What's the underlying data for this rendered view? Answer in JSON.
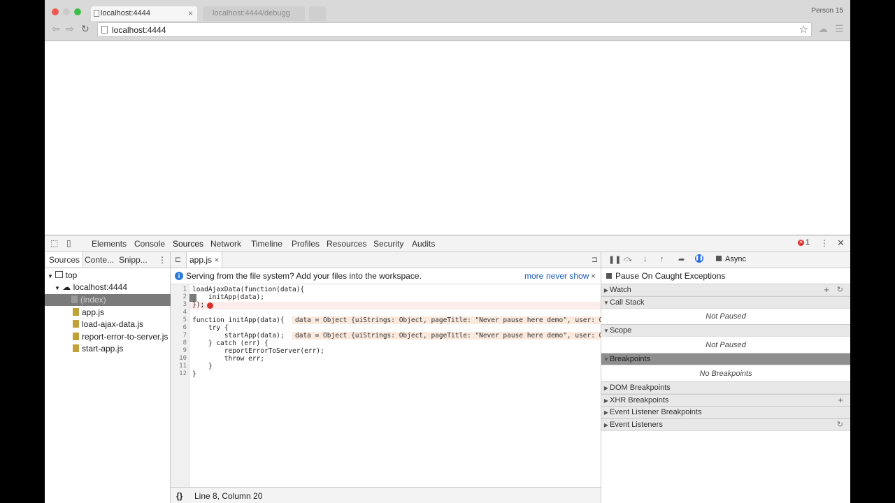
{
  "browser": {
    "tabs": [
      {
        "title": "localhost:4444"
      },
      {
        "title": "localhost:4444/debugg"
      }
    ],
    "profile": "Person 15",
    "url": "localhost:4444"
  },
  "devtools": {
    "tabs": [
      "Elements",
      "Console",
      "Sources",
      "Network",
      "Timeline",
      "Profiles",
      "Resources",
      "Security",
      "Audits"
    ],
    "active_tab": "Sources",
    "error_count": "1",
    "navigator": {
      "tabs": [
        "Sources",
        "Conte...",
        "Snipp..."
      ],
      "tree": [
        {
          "label": "top"
        },
        {
          "label": "localhost:4444"
        },
        {
          "label": "(index)"
        },
        {
          "label": "app.js"
        },
        {
          "label": "load-ajax-data.js"
        },
        {
          "label": "report-error-to-server.js"
        },
        {
          "label": "start-app.js"
        }
      ]
    },
    "editor": {
      "open_file": "app.js",
      "infobar_text": "Serving from the file system? Add your files into the workspace.",
      "infobar_more": "more",
      "infobar_never": "never show",
      "line_numbers": [
        "1",
        "2",
        "3",
        "4",
        "5",
        "6",
        "7",
        "8",
        "9",
        "10",
        "11",
        "12"
      ],
      "lines": [
        "loadAjaxData(function(data){",
        "    initApp(data);",
        "});",
        "",
        "function initApp(data){",
        "    try {",
        "        startApp(data);",
        "    } catch (err) {",
        "        reportErrorToServer(err);",
        "        throw err;",
        "    }",
        "}"
      ],
      "inline_values": [
        "data = Object {uiStrings: Object, pageTitle: \"Never pause here demo\", user: Object}",
        "data = Object {uiStrings: Object, pageTitle: \"Never pause here demo\", user: Object}"
      ],
      "status": "Line 8, Column 20"
    },
    "sidebar": {
      "async_label": "Async",
      "pause_caught": "Pause On Caught Exceptions",
      "sections": {
        "watch": "Watch",
        "call_stack": "Call Stack",
        "call_stack_state": "Not Paused",
        "scope": "Scope",
        "scope_state": "Not Paused",
        "breakpoints": "Breakpoints",
        "breakpoints_state": "No Breakpoints",
        "dom": "DOM Breakpoints",
        "xhr": "XHR Breakpoints",
        "event_listener_bp": "Event Listener Breakpoints",
        "event_listeners": "Event Listeners"
      }
    }
  }
}
